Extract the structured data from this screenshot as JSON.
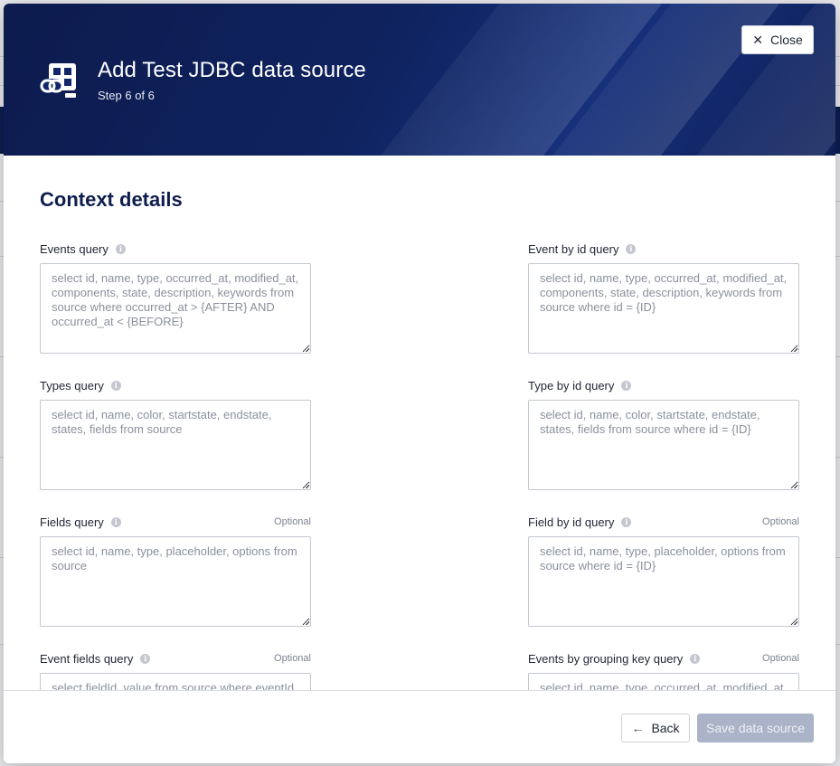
{
  "dialog": {
    "title": "Add Test JDBC data source",
    "step": "Step 6 of 6",
    "close_label": "Close",
    "section_title": "Context details"
  },
  "fields": [
    {
      "label": "Events query",
      "optional": "",
      "placeholder": "select id, name, type, occurred_at, modified_at, components, state, description, keywords from source where occurred_at > {AFTER} AND occurred_at < {BEFORE}"
    },
    {
      "label": "Event by id query",
      "optional": "",
      "placeholder": "select id, name, type, occurred_at, modified_at, components, state, description, keywords from source where id = {ID}"
    },
    {
      "label": "Types query",
      "optional": "",
      "placeholder": "select id, name, color, startstate, endstate, states, fields from source"
    },
    {
      "label": "Type by id query",
      "optional": "",
      "placeholder": "select id, name, color, startstate, endstate, states, fields from source where id = {ID}"
    },
    {
      "label": "Fields query",
      "optional": "Optional",
      "placeholder": "select id, name, type, placeholder, options from source"
    },
    {
      "label": "Field by id query",
      "optional": "Optional",
      "placeholder": "select id, name, type, placeholder, options from source where id = {ID}"
    },
    {
      "label": "Event fields query",
      "optional": "Optional",
      "placeholder": "select fieldId, value from source where eventId = {ID}"
    },
    {
      "label": "Events by grouping key query",
      "optional": "Optional",
      "placeholder": "select id, name, type, occurred_at, modified_at"
    }
  ],
  "footer": {
    "back_label": "Back",
    "save_label": "Save data source"
  },
  "colors": {
    "header_bg": "#0f2360",
    "title_color": "#0f1d4f",
    "save_disabled": "#aab3c7"
  },
  "icons": {
    "header": "data-source-link-icon",
    "close": "close-icon",
    "info": "info-icon",
    "back": "arrow-left-icon"
  }
}
